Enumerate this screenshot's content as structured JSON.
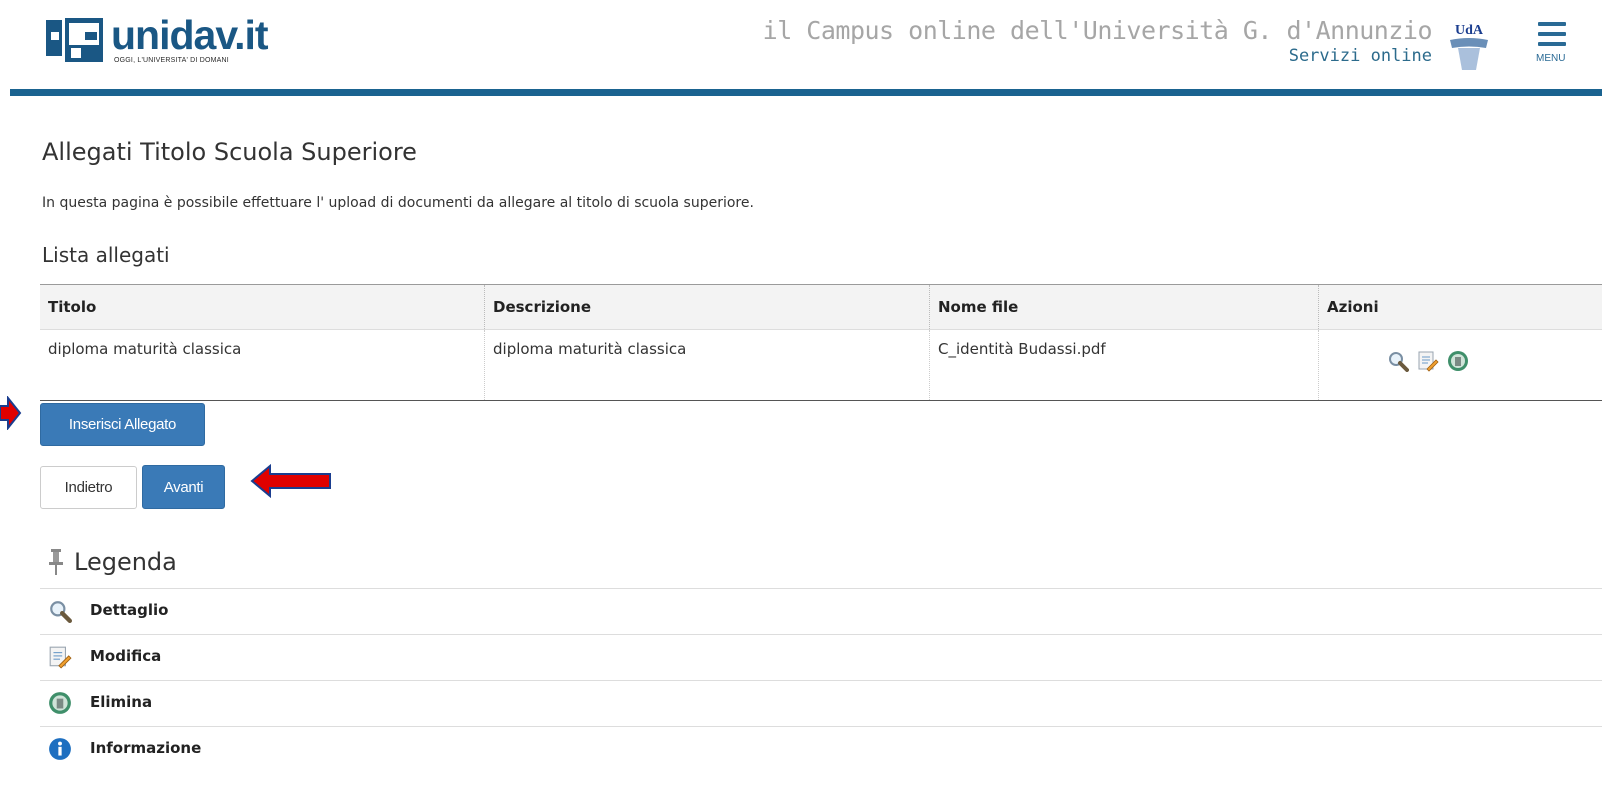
{
  "header": {
    "logo_name": "unidav.it",
    "logo_tagline": "OGGI, L'UNIVERSITA' DI DOMANI",
    "campus_title": "il Campus online dell'Università G. d'Annunzio",
    "campus_subtitle": "Servizi online",
    "uda_logo_text": "UdA",
    "menu_label": "MENU"
  },
  "page": {
    "title": "Allegati Titolo Scuola Superiore",
    "description": "In questa pagina è possibile effettuare l' upload di documenti da allegare al titolo di scuola superiore.",
    "list_title": "Lista allegati"
  },
  "table": {
    "headers": [
      "Titolo",
      "Descrizione",
      "Nome file",
      "Azioni"
    ],
    "rows": [
      {
        "titolo": "diploma maturità classica",
        "descrizione": "diploma maturità classica",
        "nome_file": "C_identità Budassi.pdf",
        "azioni": [
          "search-icon",
          "edit-icon",
          "delete-icon"
        ]
      }
    ]
  },
  "buttons": {
    "insert": "Inserisci Allegato",
    "back": "Indietro",
    "next": "Avanti"
  },
  "legend": {
    "title": "Legenda",
    "items": [
      {
        "label": "Dettaglio",
        "icon": "search-icon"
      },
      {
        "label": "Modifica",
        "icon": "edit-icon"
      },
      {
        "label": "Elimina",
        "icon": "delete-icon"
      },
      {
        "label": "Informazione",
        "icon": "info-icon"
      }
    ]
  },
  "colors": {
    "brand_blue": "#1a6390",
    "button_primary": "#3a7ab7",
    "annotation_arrow": "#e00000"
  }
}
